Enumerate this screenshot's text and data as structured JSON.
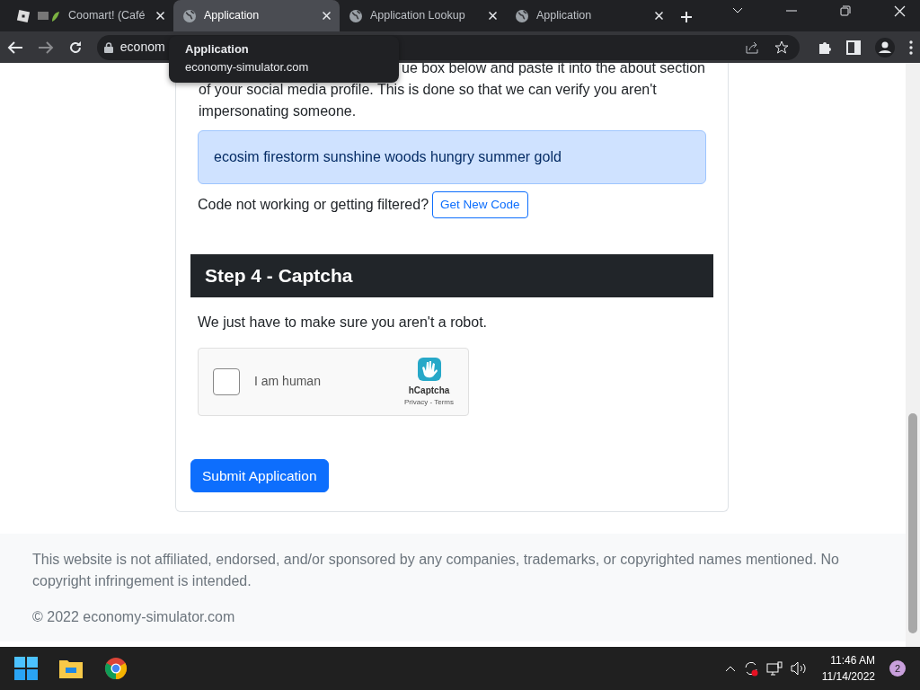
{
  "browser": {
    "tabs": [
      {
        "title": "Coomart! (Café",
        "selected": false,
        "kind": "game"
      },
      {
        "title": "Application",
        "selected": true,
        "kind": "web"
      },
      {
        "title": "Application Lookup",
        "selected": false,
        "kind": "web"
      },
      {
        "title": "Application",
        "selected": false,
        "kind": "web"
      }
    ],
    "address": "econom",
    "tooltip": {
      "title": "Application",
      "url": "economy-simulator.com"
    }
  },
  "page": {
    "intro_lines": [
      "ue box below and paste it into the about section",
      "of your social media profile. This is done so that we can verify you aren't",
      "impersonating someone."
    ],
    "code": "ecosim firestorm sunshine woods hungry summer gold",
    "code_prompt": "Code not working or getting filtered?",
    "new_code_button": "Get New Code",
    "step_heading": "Step 4 - Captcha",
    "step_text": "We just have to make sure you aren't a robot.",
    "captcha": {
      "label": "I am human",
      "checked": false,
      "brand": "hCaptcha",
      "links": "Privacy - Terms"
    },
    "submit": "Submit Application"
  },
  "footer": {
    "disclaimer": "This website is not affiliated, endorsed, and/or sponsored by any companies, trademarks, or copyrighted names mentioned. No copyright infringement is intended.",
    "copyright": "© 2022 economy-simulator.com"
  },
  "taskbar": {
    "time": "11:46 AM",
    "date": "11/14/2022",
    "notifications": "2"
  }
}
